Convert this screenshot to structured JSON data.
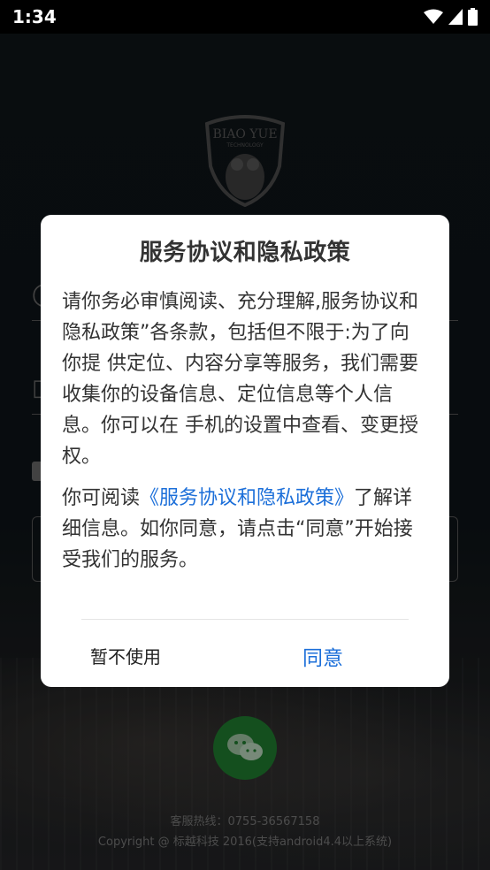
{
  "status_bar": {
    "time": "1:34",
    "icons": [
      "wifi-icon",
      "signal-icon",
      "battery-icon"
    ]
  },
  "logo": {
    "brand": "BIAO YUE",
    "tagline": "TECHNOLOGY"
  },
  "dialog": {
    "title": "服务协议和隐私政策",
    "paragraph1": "请你务必审慎阅读、充分理解,服务协议和隐私政策”各条款，包括但不限于:为了向你提 供定位、内容分享等服务，我们需要收集你的设备信息、定位信息等个人信息。你可以在 手机的设置中查看、变更授权。",
    "paragraph2_prefix": "你可阅读",
    "paragraph2_link": "《服务协议和隐私政策》",
    "paragraph2_suffix": "了解详细信息。如你同意，请点击“同意”开始接受我们的服务。",
    "deny_label": "暂不使用",
    "agree_label": "同意"
  },
  "footer": {
    "hotline": "客服热线：0755-36567158",
    "copyright": "Copyright @ 标越科技 2016(支持android4.4以上系统)"
  },
  "colors": {
    "accent": "#1c6fd9",
    "wechat": "#1f7a2e"
  }
}
